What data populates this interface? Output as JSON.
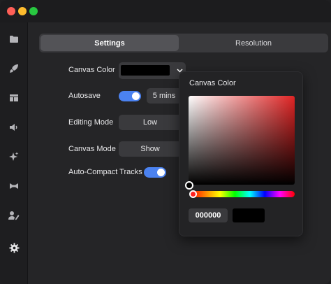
{
  "tabs": {
    "settings": "Settings",
    "resolution": "Resolution"
  },
  "settings": {
    "canvas_color_label": "Canvas Color",
    "autosave_label": "Autosave",
    "autosave_value": "5 mins",
    "editing_mode_label": "Editing Mode",
    "editing_mode_value": "Low",
    "canvas_mode_label": "Canvas Mode",
    "canvas_mode_value": "Show",
    "auto_compact_label": "Auto-Compact Tracks"
  },
  "toggles": {
    "autosave_on": true,
    "auto_compact_on": true
  },
  "color_picker": {
    "title": "Canvas Color",
    "hex_value": "000000",
    "selected_color": "#000000",
    "hue_color": "#e02424"
  },
  "sidebar": {
    "icons": [
      "folder-icon",
      "rocket-icon",
      "layout-icon",
      "speaker-icon",
      "sparkle-icon",
      "bowtie-icon",
      "user-edit-icon",
      "gear-icon"
    ]
  },
  "colors": {
    "accent": "#4b82f0"
  }
}
